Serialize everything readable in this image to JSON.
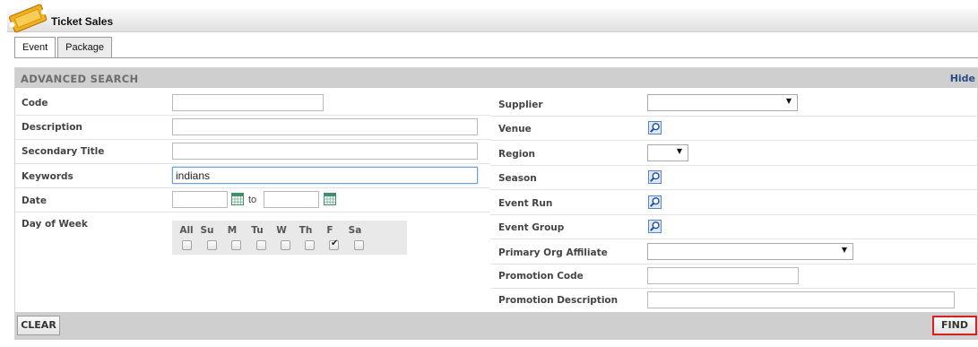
{
  "app": {
    "title": "Ticket Sales",
    "accent": "#f2b01e"
  },
  "tabs": [
    {
      "label": "Event",
      "active": true
    },
    {
      "label": "Package",
      "active": false
    }
  ],
  "panel": {
    "title": "ADVANCED SEARCH",
    "hide_label": "Hide"
  },
  "left": {
    "code": {
      "label": "Code",
      "value": ""
    },
    "description": {
      "label": "Description",
      "value": ""
    },
    "secondary_title": {
      "label": "Secondary Title",
      "value": ""
    },
    "keywords": {
      "label": "Keywords",
      "value": "indians"
    },
    "date": {
      "label": "Date",
      "from": "",
      "to_label": "to",
      "to": ""
    },
    "day_of_week": {
      "label": "Day of Week",
      "days": [
        "All",
        "Su",
        "M",
        "Tu",
        "W",
        "Th",
        "F",
        "Sa"
      ],
      "checked": [
        false,
        false,
        false,
        false,
        false,
        false,
        true,
        false
      ]
    }
  },
  "right": {
    "supplier": {
      "label": "Supplier",
      "value": ""
    },
    "venue": {
      "label": "Venue"
    },
    "region": {
      "label": "Region",
      "value": ""
    },
    "season": {
      "label": "Season"
    },
    "event_run": {
      "label": "Event Run"
    },
    "event_group": {
      "label": "Event Group"
    },
    "primary_org_affiliate": {
      "label": "Primary Org Affiliate",
      "value": ""
    },
    "promotion_code": {
      "label": "Promotion Code",
      "value": ""
    },
    "promotion_description": {
      "label": "Promotion Description",
      "value": ""
    }
  },
  "footer": {
    "clear_label": "CLEAR",
    "find_label": "FIND",
    "find_highlight": "#d42020"
  },
  "icons": {
    "ticket": "ticket-icon",
    "calendar": "calendar-icon",
    "lookup": "magnifier-icon",
    "dropdown": "chevron-down-icon"
  }
}
